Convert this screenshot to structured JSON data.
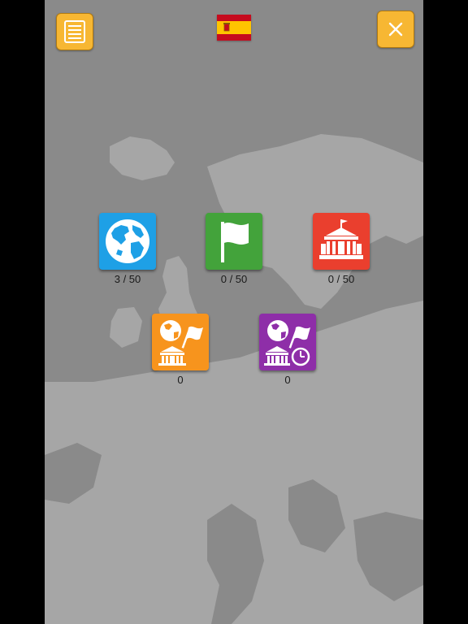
{
  "header": {
    "menu_icon": "menu-list-icon",
    "close_icon": "close-icon",
    "flag": "spain-flag",
    "accent_color": "#f7b733"
  },
  "modes": [
    {
      "id": "world",
      "icon": "globe-icon",
      "color": "#1ea0e6",
      "progress": "3 / 50",
      "done": 3,
      "total": 50
    },
    {
      "id": "flags",
      "icon": "flag-icon",
      "color": "#43a33b",
      "progress": "0 / 50",
      "done": 0,
      "total": 50
    },
    {
      "id": "capitals",
      "icon": "capitol-building-icon",
      "color": "#ea3f2e",
      "progress": "0 / 50",
      "done": 0,
      "total": 50
    },
    {
      "id": "mixed",
      "icon": "globe-flag-building-icon",
      "color": "#f7941d",
      "score": "0"
    },
    {
      "id": "timed",
      "icon": "globe-flag-building-clock-icon",
      "color": "#8e2ea8",
      "score": "0"
    }
  ]
}
